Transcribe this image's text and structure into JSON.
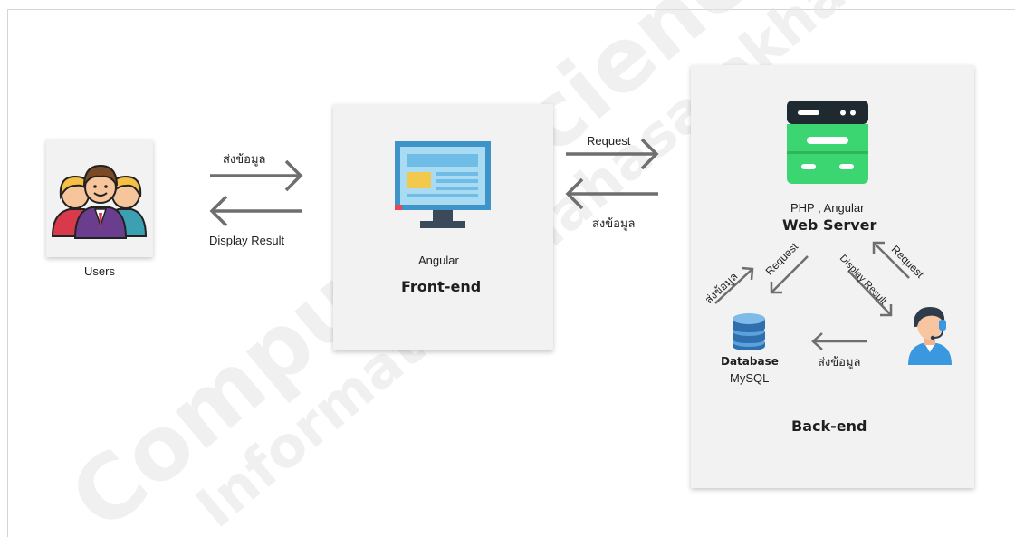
{
  "users": {
    "label": "Users",
    "icon": "users-group-icon"
  },
  "user_frontend": {
    "send_label": "ส่งข้อมูล",
    "result_label": "Display Result"
  },
  "frontend": {
    "tech": "Angular",
    "title": "Front-end",
    "icon": "monitor-icon"
  },
  "frontend_backend": {
    "request_label": "Request",
    "send_label": "ส่งข้อมูล"
  },
  "web_server": {
    "tech": "PHP , Angular",
    "title": "Web Server",
    "icon": "server-icon"
  },
  "backend_flows": {
    "db_send_label": "ส่งข้อมูล",
    "db_request_label": "Request",
    "admin_request_label": "Request",
    "admin_result_label": "Display Result",
    "admin_db_send_label": "ส่งข้อมูล"
  },
  "database": {
    "title": "Database",
    "tech": "MySQL",
    "icon": "database-icon"
  },
  "admin": {
    "icon": "support-agent-icon"
  },
  "backend": {
    "title": "Back-end"
  },
  "watermark": {
    "line1": "Computer Science Dep",
    "line2": "Informatics, Mahasarakham"
  },
  "colors": {
    "arrow": "#6e6e6e",
    "server_green": "#3bd671",
    "server_dark": "#1f2a30",
    "monitor_blue": "#3e93c9",
    "db_blue": "#2f6fae"
  }
}
